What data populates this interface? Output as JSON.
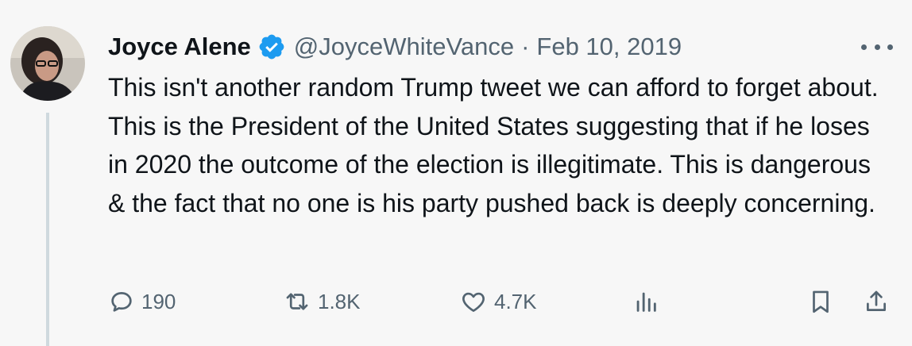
{
  "tweet": {
    "author_name": "Joyce Alene",
    "handle": "@JoyceWhiteVance",
    "separator": "·",
    "date": "Feb 10, 2019",
    "text": "This isn't another random Trump tweet we can afford to forget about. This is the President of the United States suggesting that if he loses in 2020 the outcome of the election is illegitimate. This is dangerous & the fact that no one is his party pushed back is deeply concerning.",
    "replies": "190",
    "retweets": "1.8K",
    "likes": "4.7K"
  },
  "colors": {
    "background": "#f7f7f7",
    "text": "#0f1419",
    "secondary": "#536471",
    "verified": "#1d9bf0",
    "thread_line": "#cfd9de"
  },
  "icons": {
    "verified": "verified-badge-icon",
    "more": "more-dots-icon",
    "reply": "reply-bubble-icon",
    "retweet": "retweet-icon",
    "like": "heart-icon",
    "views": "analytics-bars-icon",
    "bookmark": "bookmark-icon",
    "share": "share-upload-icon"
  }
}
